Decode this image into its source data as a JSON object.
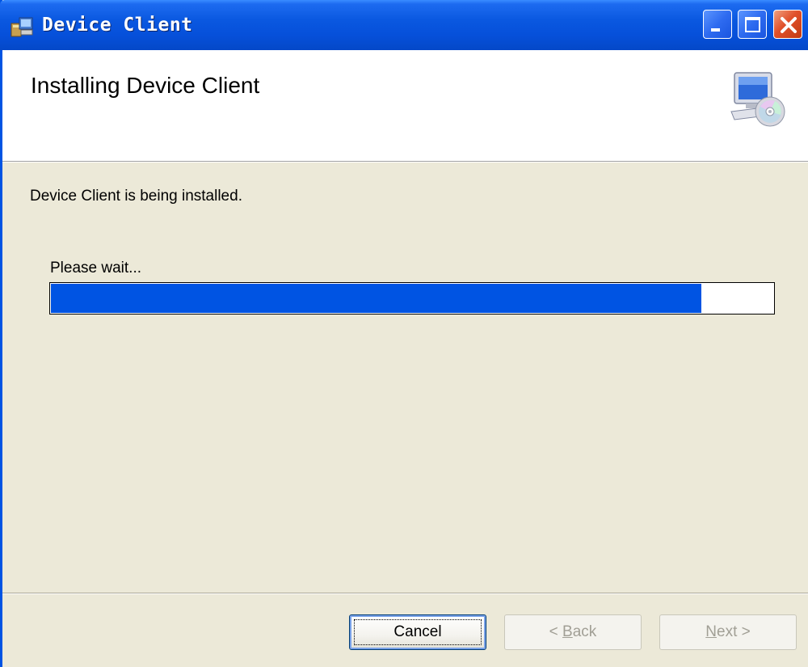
{
  "window": {
    "title": "Device Client",
    "controls": [
      "minimize",
      "maximize",
      "close"
    ]
  },
  "banner": {
    "title": "Installing Device Client",
    "icon": "computer-cd-icon"
  },
  "body": {
    "status": "Device Client is being installed.",
    "wait_label": "Please wait...",
    "progress": 0.9
  },
  "buttons": {
    "cancel": "Cancel",
    "back_mnemonic": "B",
    "back_rest": "ack",
    "back_prefix": "< ",
    "next_mnemonic": "N",
    "next_rest": "ext",
    "next_suffix": " >"
  },
  "colors": {
    "titlebar": "#0A58E0",
    "progress_fill": "#0054E3",
    "face": "#ECE9D8"
  }
}
